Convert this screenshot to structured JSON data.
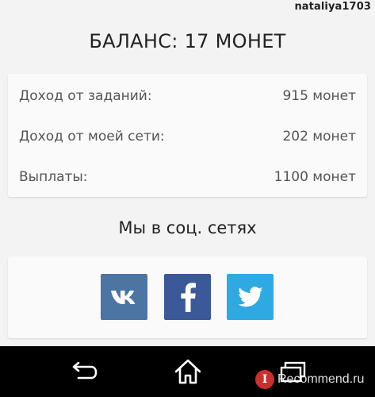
{
  "header": {
    "username": "nataliya1703",
    "balance": "БАЛАНС: 17 МОНЕТ"
  },
  "stats": [
    {
      "label": "Доход от заданий:",
      "value": "915 монет"
    },
    {
      "label": "Доход от моей сети:",
      "value": "202 монет"
    },
    {
      "label": "Выплаты:",
      "value": "1100 монет"
    }
  ],
  "social": {
    "title": "Мы в соц. сетях",
    "buttons": [
      {
        "icon": "vk-icon",
        "color": "#4c75a3"
      },
      {
        "icon": "facebook-icon",
        "color": "#3b5998"
      },
      {
        "icon": "twitter-icon",
        "color": "#2ea9e1"
      }
    ]
  },
  "navbar": {
    "icons": [
      "back-icon",
      "home-icon",
      "recent-apps-icon"
    ]
  },
  "watermark": {
    "logo": "I",
    "text": "Recommend.ru"
  }
}
